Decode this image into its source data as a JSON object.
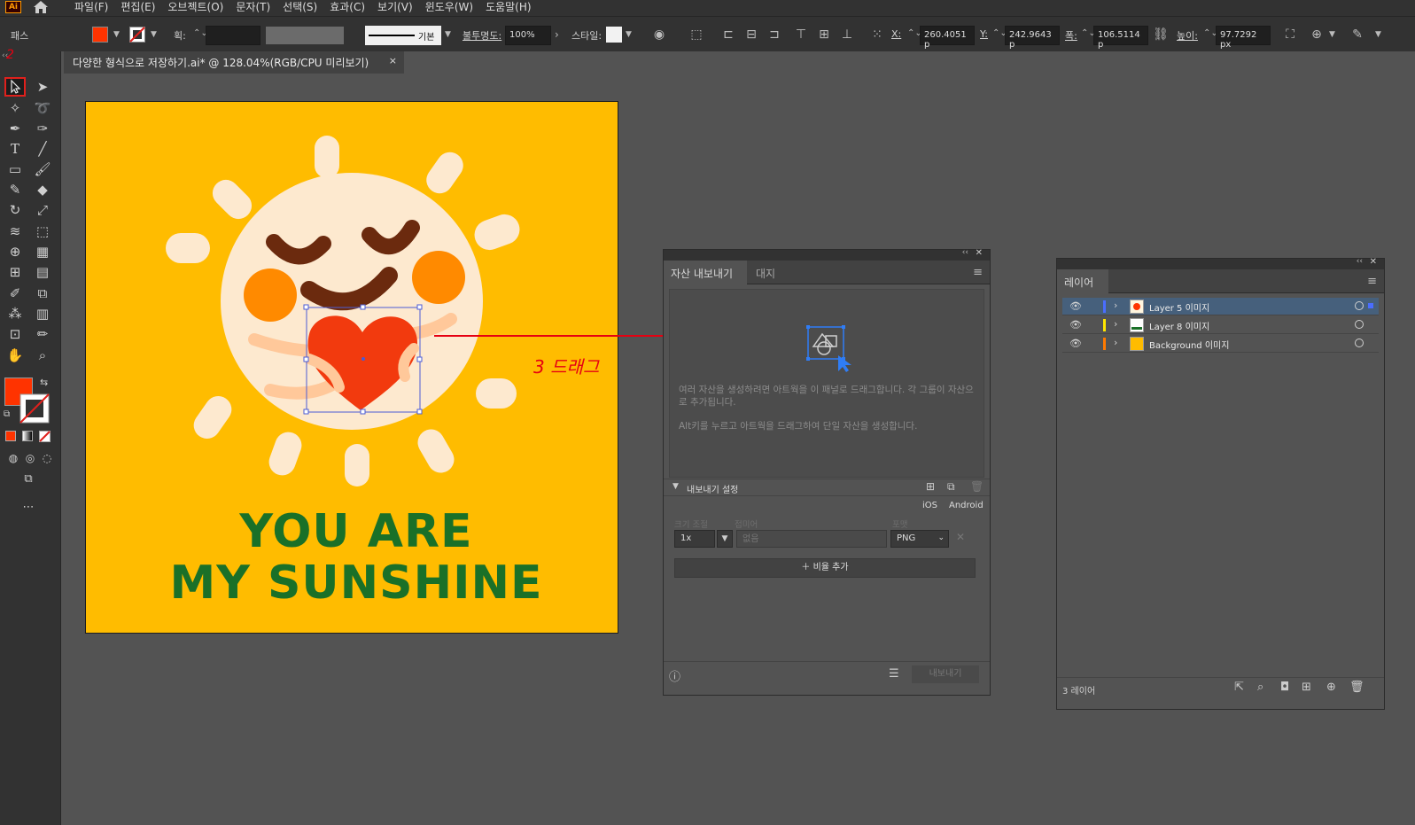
{
  "app": {
    "logo_text": "Ai",
    "menu": [
      "파일(F)",
      "편집(E)",
      "오브젝트(O)",
      "문자(T)",
      "선택(S)",
      "효과(C)",
      "보기(V)",
      "윈도우(W)",
      "도움말(H)"
    ]
  },
  "controlbar": {
    "object_type": "패스",
    "stroke_label": "획:",
    "stroke_style": "기본",
    "opacity_label": "불투명도:",
    "opacity_value": "100%",
    "style_label": "스타일:",
    "x_label": "X:",
    "x_value": "260.4051 p",
    "y_label": "Y:",
    "y_value": "242.9643 p",
    "w_label": "폭:",
    "w_value": "106.5114 p",
    "h_label": "높이:",
    "h_value": "97.7292 px",
    "colors": {
      "fill": "#ff3300",
      "accent": "#e0201c"
    }
  },
  "document": {
    "tab_title": "다양한 형식으로 저장하기.ai* @ 128.04%(RGB/CPU 미리보기)",
    "close_symbol": "×"
  },
  "artwork": {
    "line1": "YOU ARE",
    "line2": "MY SUNSHINE",
    "background_color": "#ffbc00",
    "text_color": "#1a7028"
  },
  "annotations": {
    "step2": "2",
    "step3": "3 드래그"
  },
  "asset_panel": {
    "tabs": [
      "자산 내보내기",
      "대지"
    ],
    "help_text_1": "여러 자산을 생성하려면 아트웍을 이 패널로 드래그합니다. 각 그룹이 자산으로 추가됩니다.",
    "help_text_2": "Alt키를 누르고 아트웍을 드래그하여 단일 자산을 생성합니다.",
    "export_settings": "내보내기 설정",
    "platforms": [
      "iOS",
      "Android"
    ],
    "col_scale": "크기 조절",
    "col_suffix": "접미어",
    "col_format": "포맷",
    "scale_value": "1x",
    "suffix_placeholder": "없음",
    "format_value": "PNG",
    "add_scale": "비율 추가",
    "export_button": "내보내기"
  },
  "layers_panel": {
    "tab": "레이어",
    "layers": [
      {
        "name": "Layer 5 이미지",
        "color": "#4a6dff",
        "selected": true
      },
      {
        "name": "Layer 8 이미지",
        "color": "#ffe600",
        "selected": false
      },
      {
        "name": "Background 이미지",
        "color": "#ff7a00",
        "selected": false
      }
    ],
    "count": "3 레이어"
  }
}
